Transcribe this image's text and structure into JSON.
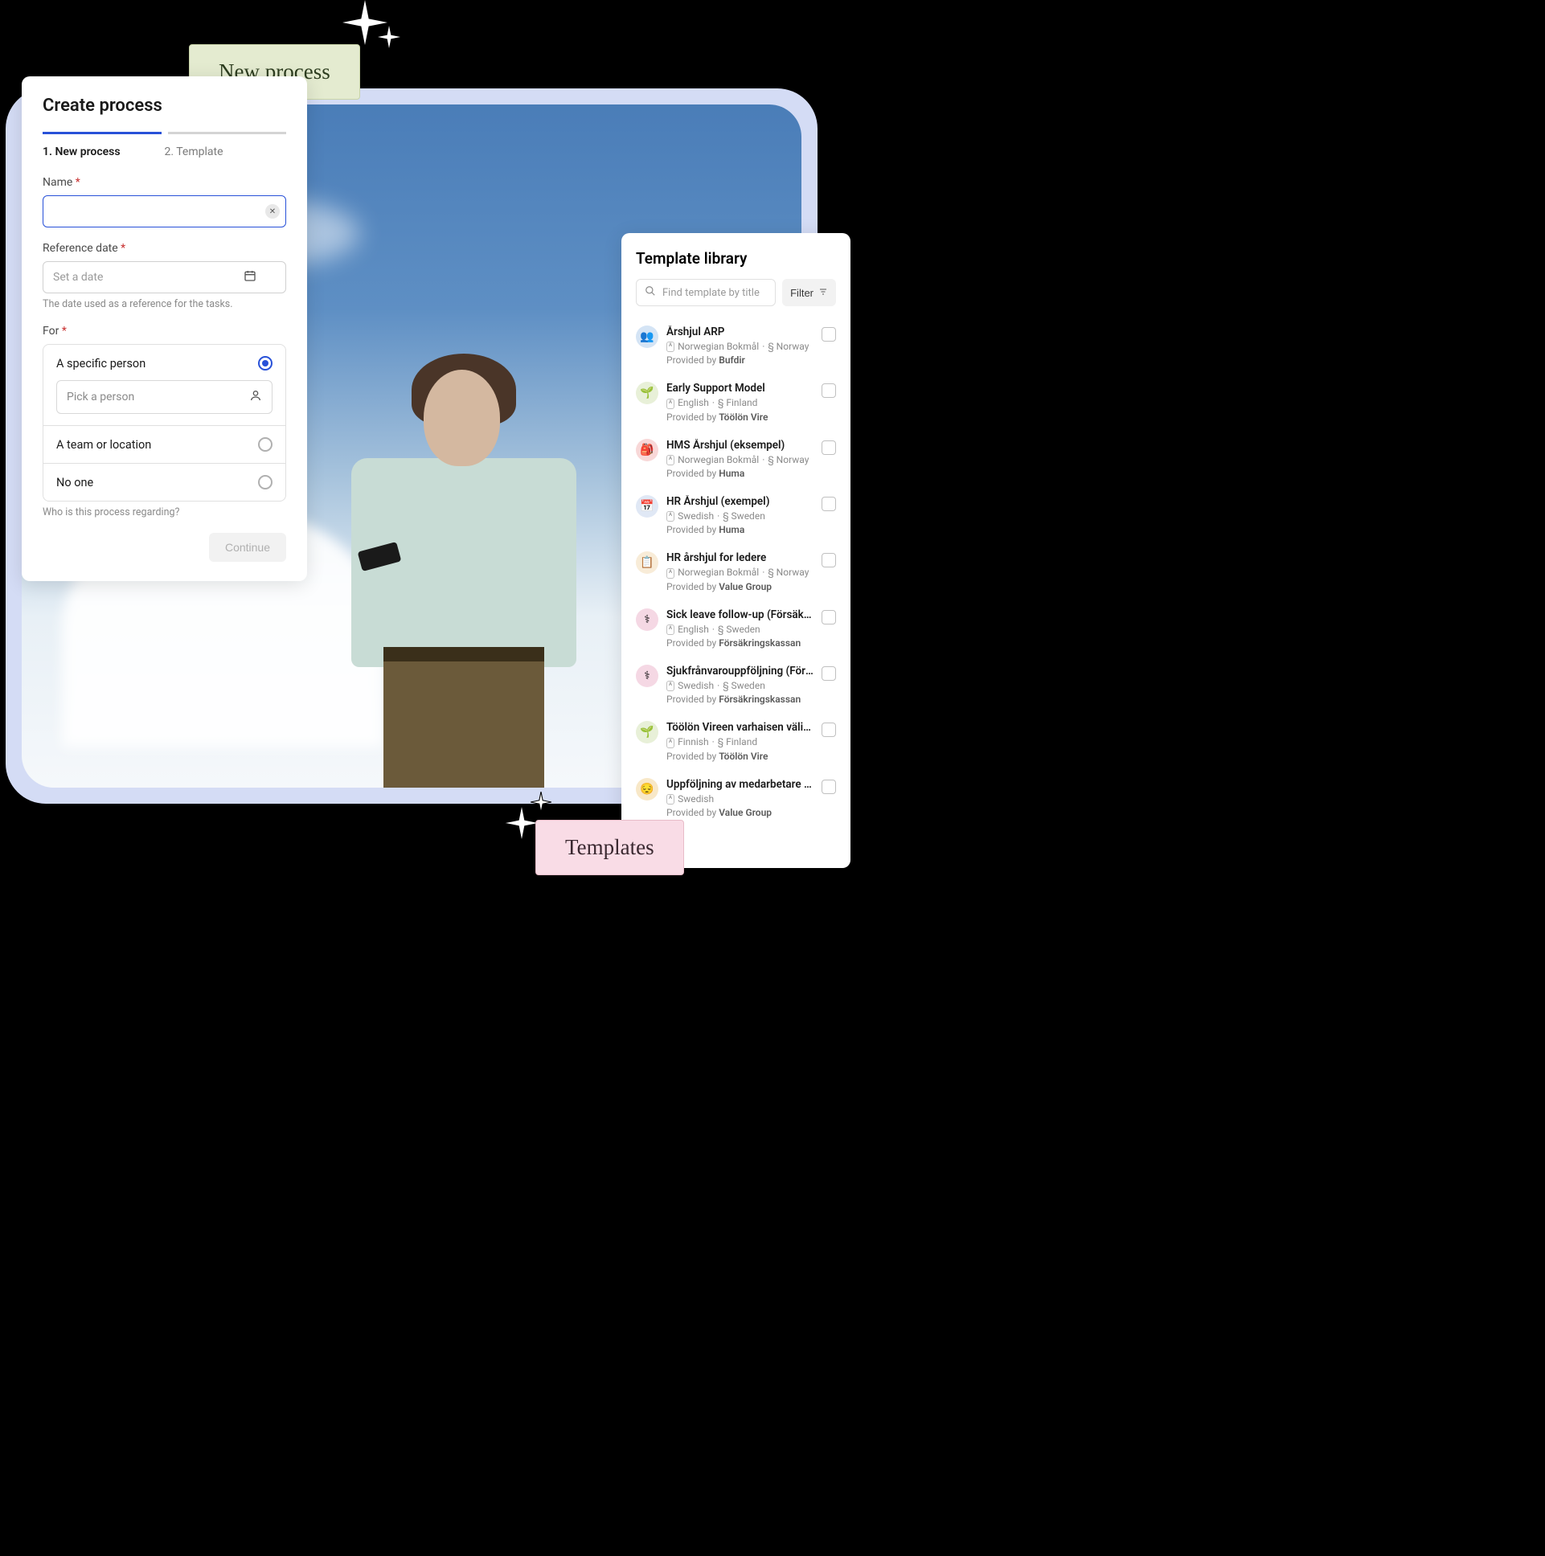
{
  "badges": {
    "new_process": "New process",
    "templates": "Templates"
  },
  "create": {
    "title": "Create process",
    "steps": {
      "s1": "1. New process",
      "s2": "2. Template"
    },
    "name_label": "Name",
    "date_label": "Reference date",
    "date_placeholder": "Set a date",
    "date_help": "The date used as a reference for the tasks.",
    "for_label": "For",
    "for_help": "Who is this process regarding?",
    "options": {
      "specific": "A specific person",
      "team": "A team or location",
      "none": "No one"
    },
    "person_placeholder": "Pick a person",
    "continue": "Continue"
  },
  "library": {
    "title": "Template library",
    "search_placeholder": "Find template by title",
    "filter": "Filter",
    "provided_by": "Provided by",
    "items": [
      {
        "title": "Årshjul ARP",
        "lang": "Norwegian Bokmål",
        "region": "§ Norway",
        "provider": "Bufdir",
        "icon": "👥",
        "bg": "#d4e4f5"
      },
      {
        "title": "Early Support Model",
        "lang": "English",
        "region": "§ Finland",
        "provider": "Töölön Vire",
        "icon": "🌱",
        "bg": "#e8f0d8"
      },
      {
        "title": "HMS Årshjul (eksempel)",
        "lang": "Norwegian Bokmål",
        "region": "§ Norway",
        "provider": "Huma",
        "icon": "🎒",
        "bg": "#f8d8d8"
      },
      {
        "title": "HR Årshjul (exempel)",
        "lang": "Swedish",
        "region": "§ Sweden",
        "provider": "Huma",
        "icon": "📅",
        "bg": "#e0e8f5"
      },
      {
        "title": "HR årshjul for ledere",
        "lang": "Norwegian Bokmål",
        "region": "§ Norway",
        "provider": "Value Group",
        "icon": "📋",
        "bg": "#f8ecd8"
      },
      {
        "title": "Sick leave follow-up (Försäkrings…",
        "lang": "English",
        "region": "§ Sweden",
        "provider": "Försäkringskassan",
        "icon": "⚕",
        "bg": "#f5d8e4"
      },
      {
        "title": "Sjukfrånvarouppföljning (Försäkri…",
        "lang": "Swedish",
        "region": "§ Sweden",
        "provider": "Försäkringskassan",
        "icon": "⚕",
        "bg": "#f5d8e4"
      },
      {
        "title": "Töölön Vireen varhaisen välittäm…",
        "lang": "Finnish",
        "region": "§ Finland",
        "provider": "Töölön Vire",
        "icon": "🌱",
        "bg": "#e8f0d8"
      },
      {
        "title": "Uppföljning av medarbetare und…",
        "lang": "Swedish",
        "region": "",
        "provider": "Value Group",
        "icon": "😔",
        "bg": "#f8e8c8"
      }
    ]
  }
}
